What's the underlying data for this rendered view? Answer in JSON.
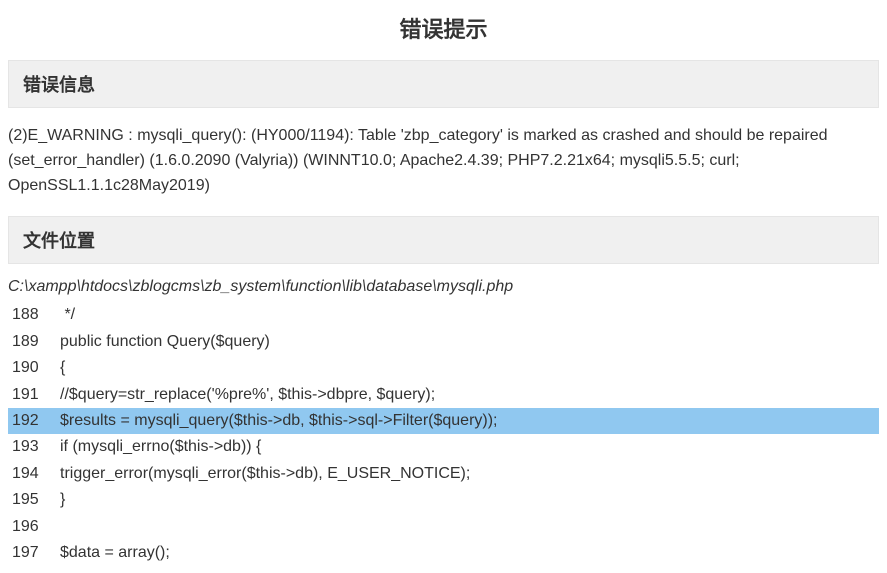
{
  "page_title": "错误提示",
  "sections": {
    "error_info_header": "错误信息",
    "file_location_header": "文件位置"
  },
  "error_message": "(2)E_WARNING : mysqli_query(): (HY000/1194): Table 'zbp_category' is marked as crashed and should be repaired (set_error_handler) (1.6.0.2090 (Valyria)) (WINNT10.0; Apache2.4.39; PHP7.2.21x64; mysqli5.5.5; curl; OpenSSL1.1.1c28May2019)",
  "file_path": "C:\\xampp\\htdocs\\zblogcms\\zb_system\\function\\lib\\database\\mysqli.php",
  "code": {
    "highlight_line": "192",
    "lines": [
      {
        "num": "188",
        "content": " */"
      },
      {
        "num": "189",
        "content": "public function Query($query)"
      },
      {
        "num": "190",
        "content": "{"
      },
      {
        "num": "191",
        "content": "//$query=str_replace('%pre%', $this->dbpre, $query);"
      },
      {
        "num": "192",
        "content": "$results = mysqli_query($this->db, $this->sql->Filter($query));"
      },
      {
        "num": "193",
        "content": "if (mysqli_errno($this->db)) {"
      },
      {
        "num": "194",
        "content": "trigger_error(mysqli_error($this->db), E_USER_NOTICE);"
      },
      {
        "num": "195",
        "content": "}"
      },
      {
        "num": "196",
        "content": ""
      },
      {
        "num": "197",
        "content": "$data = array();"
      }
    ]
  }
}
